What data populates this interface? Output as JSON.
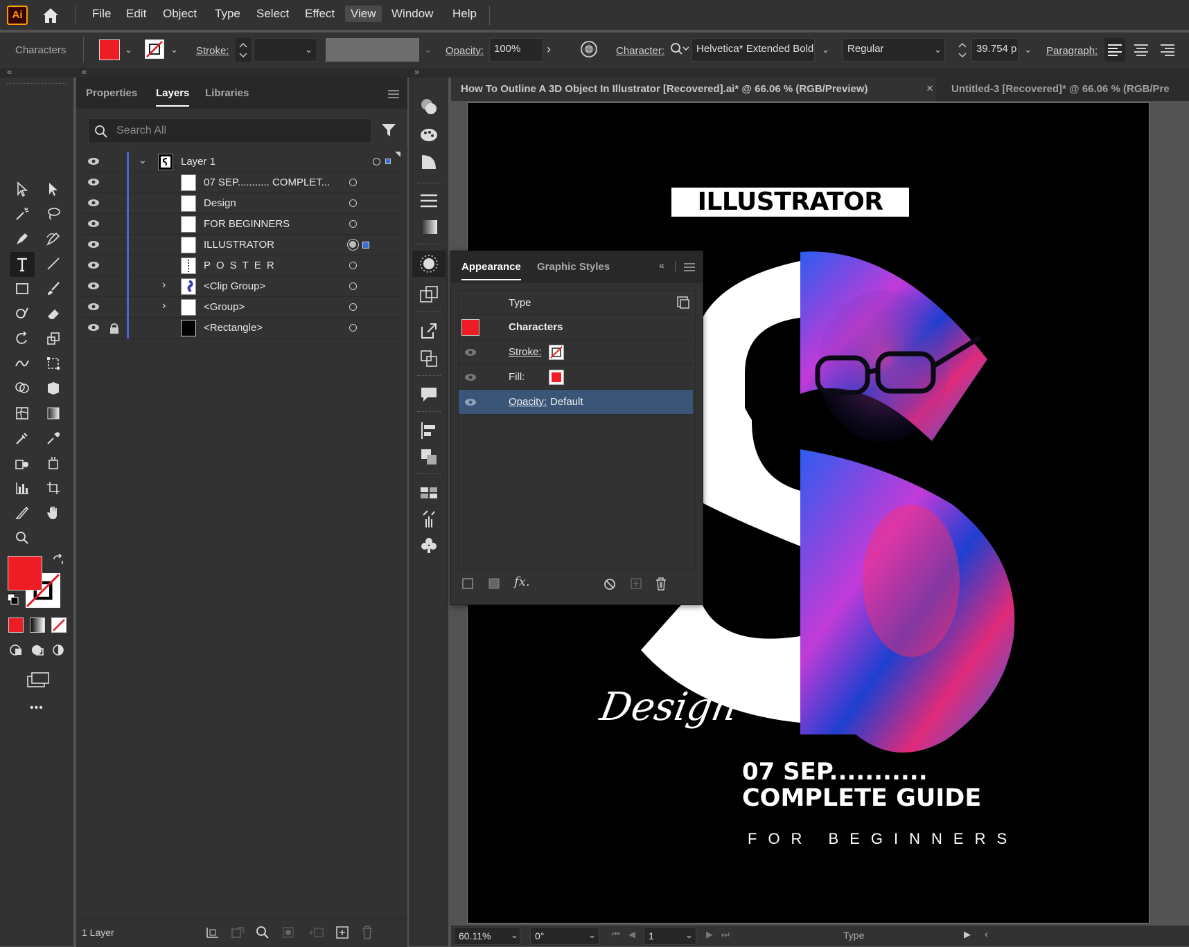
{
  "menubar": {
    "app_logo": "Ai",
    "items": [
      "File",
      "Edit",
      "Object",
      "Type",
      "Select",
      "Effect",
      "View",
      "Window",
      "Help"
    ],
    "selected": "View"
  },
  "control": {
    "selection_label": "Characters",
    "stroke_label": "Stroke:",
    "opacity_label": "Opacity:",
    "opacity_value": "100%",
    "character_label": "Character:",
    "font_family": "Helvetica* Extended Bold",
    "font_style": "Regular",
    "font_size": "39.754 p",
    "paragraph_label": "Paragraph:",
    "fill_color": "#ee1c25"
  },
  "layers_panel": {
    "tabs": [
      "Properties",
      "Layers",
      "Libraries"
    ],
    "active_tab": "Layers",
    "search_placeholder": "Search All",
    "rows": [
      {
        "name": "Layer 1"
      },
      {
        "name": "07 SEP........... COMPLET..."
      },
      {
        "name": "Design"
      },
      {
        "name": "FOR BEGINNERS"
      },
      {
        "name": "ILLUSTRATOR"
      },
      {
        "name": "P O S T E R"
      },
      {
        "name": "<Clip Group>"
      },
      {
        "name": "<Group>"
      },
      {
        "name": "<Rectangle>"
      }
    ],
    "footer_count": "1 Layer",
    "accent_color": "#3b6fd8"
  },
  "appearance_panel": {
    "tabs": [
      "Appearance",
      "Graphic Styles"
    ],
    "active_tab": "Appearance",
    "type_label": "Type",
    "characters_label": "Characters",
    "stroke_label": "Stroke:",
    "fill_label": "Fill:",
    "opacity_label": "Opacity:",
    "opacity_value": "Default",
    "fx_label": "fx."
  },
  "documents": {
    "tab1": "How To Outline A 3D Object In Illustrator [Recovered].ai* @ 66.06 % (RGB/Preview)",
    "tab1_close": "×",
    "tab2": "Untitled-3 [Recovered]* @ 66.06 % (RGB/Pre"
  },
  "poster": {
    "title": "ILLUSTRATOR",
    "script": "Design",
    "line1": "07 SEP...........",
    "line2": "COMPLETE GUIDE",
    "line3": "FOR BEGINNERS"
  },
  "statusbar": {
    "zoom": "60.11%",
    "rotation": "0°",
    "artboard": "1",
    "tool": "Type"
  },
  "collapse": {
    "left": "«",
    "mid": "«",
    "right": "»"
  },
  "more_tools": "•••"
}
